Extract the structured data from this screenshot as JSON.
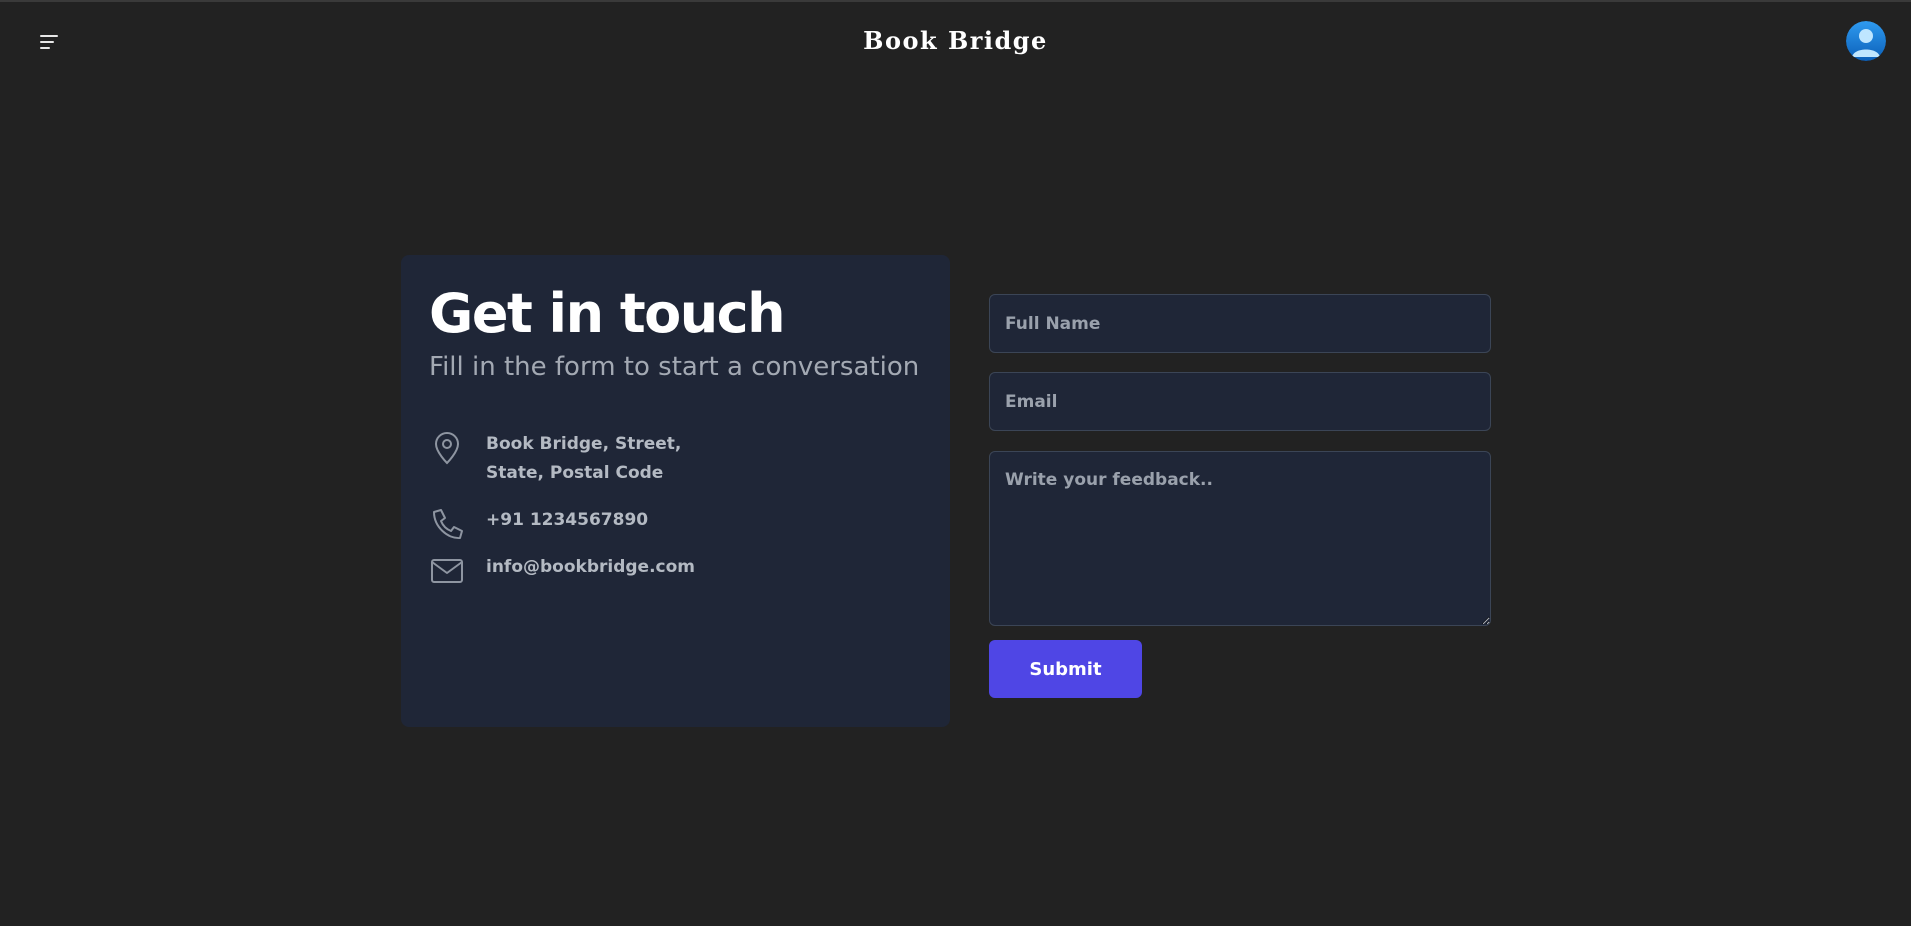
{
  "header": {
    "brand": "Book Bridge",
    "menu_icon": "hamburger-menu-icon",
    "avatar_icon": "user-avatar-icon"
  },
  "contact": {
    "title": "Get in touch",
    "subtitle": "Fill in the form to start a conversation",
    "address_line1": "Book Bridge, Street,",
    "address_line2": "State, Postal Code",
    "phone": "+91 1234567890",
    "email": "info@bookbridge.com"
  },
  "form": {
    "name_placeholder": "Full Name",
    "email_placeholder": "Email",
    "feedback_placeholder": "Write your feedback..",
    "submit_label": "Submit"
  },
  "colors": {
    "background": "#222222",
    "card": "#1f2637",
    "accent": "#4f46e5"
  }
}
